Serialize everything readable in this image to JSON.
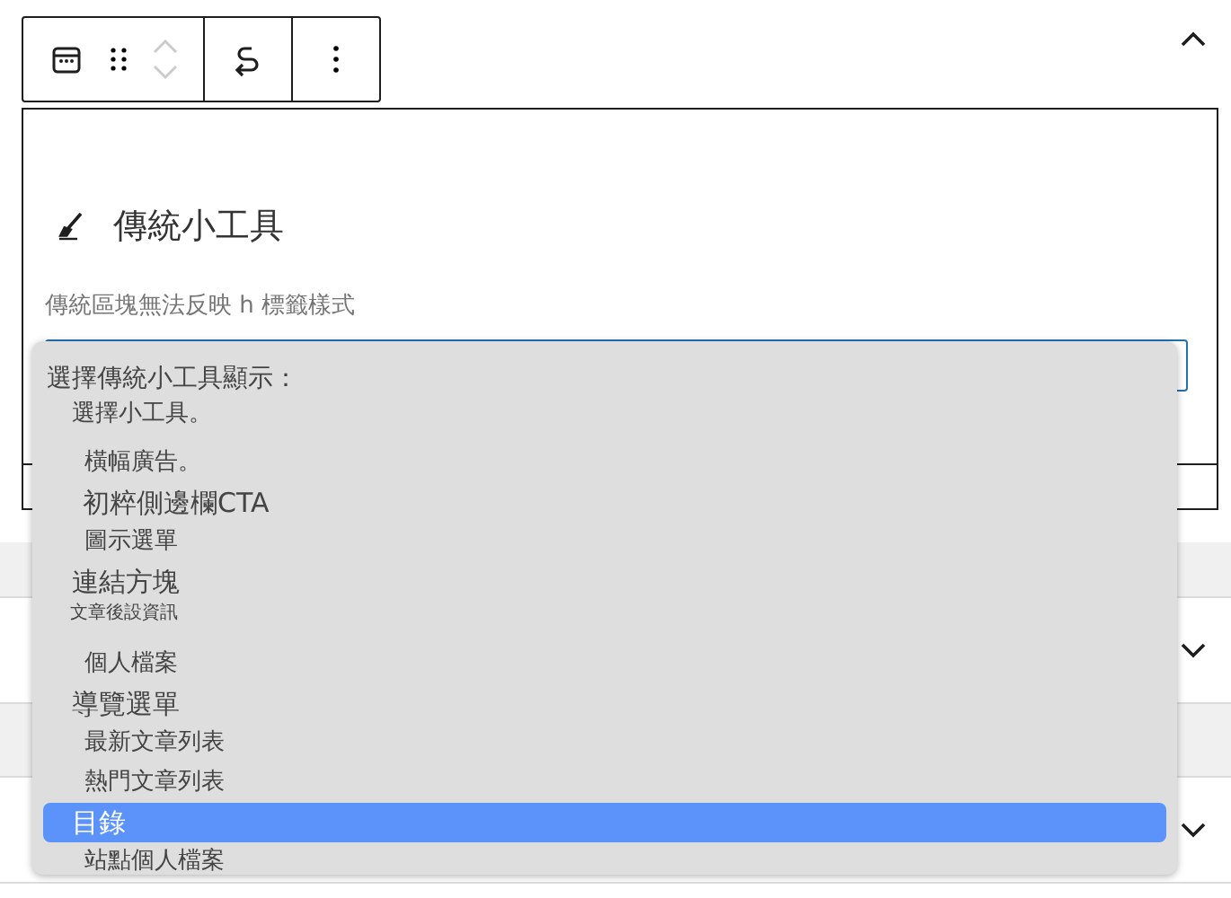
{
  "block": {
    "title": "傳統小工具",
    "note": "傳統區塊無法反映 h 標籤樣式"
  },
  "dropdown": {
    "label": "選擇傳統小工具顯示：",
    "options": [
      {
        "label": "選擇小工具。",
        "kind": "placeholder",
        "selected": false
      },
      {
        "label": "橫幅廣告。",
        "kind": "option",
        "selected": false
      },
      {
        "label": "初粹側邊欄CTA",
        "kind": "large",
        "selected": false
      },
      {
        "label": "圖示選單",
        "kind": "option",
        "selected": false
      },
      {
        "label": "連結方塊",
        "kind": "group",
        "selected": false
      },
      {
        "label": "文章後設資訊",
        "kind": "small",
        "selected": false
      },
      {
        "label": "個人檔案",
        "kind": "option",
        "selected": false
      },
      {
        "label": "導覽選單",
        "kind": "group",
        "selected": false
      },
      {
        "label": "最新文章列表",
        "kind": "option",
        "selected": false
      },
      {
        "label": "熱門文章列表",
        "kind": "option",
        "selected": false
      },
      {
        "label": "目錄",
        "kind": "group",
        "selected": true
      },
      {
        "label": "站點個人檔案",
        "kind": "option",
        "selected": false
      }
    ]
  }
}
